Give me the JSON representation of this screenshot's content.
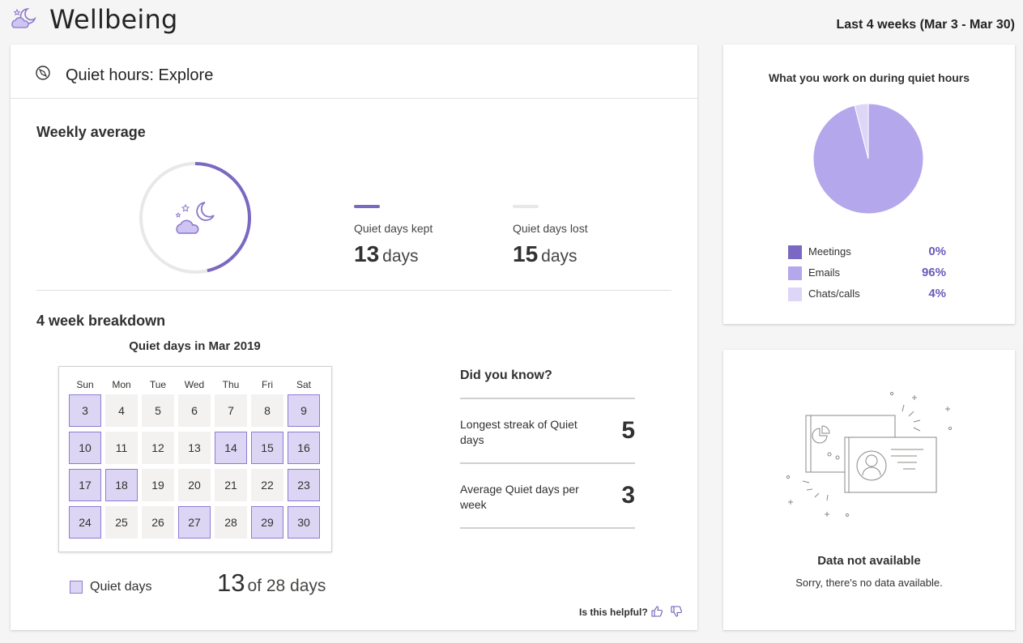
{
  "app": {
    "title": "Wellbeing",
    "date_range": "Last 4 weeks (Mar 3 - Mar 30)",
    "icon": "moon-cloud-icon"
  },
  "main": {
    "title": "Quiet hours: Explore",
    "title_icon": "compass-icon",
    "weekly_average": {
      "heading": "Weekly average",
      "kept_fraction": 0.464,
      "kept": {
        "label": "Quiet days kept",
        "value": "13",
        "unit": "days"
      },
      "lost": {
        "label": "Quiet days lost",
        "value": "15",
        "unit": "days"
      }
    },
    "breakdown": {
      "heading": "4 week breakdown",
      "calendar_title": "Quiet days in Mar 2019",
      "weekdays": [
        "Sun",
        "Mon",
        "Tue",
        "Wed",
        "Thu",
        "Fri",
        "Sat"
      ],
      "weeks": [
        [
          {
            "d": "3",
            "q": true
          },
          {
            "d": "4",
            "q": false
          },
          {
            "d": "5",
            "q": false
          },
          {
            "d": "6",
            "q": false
          },
          {
            "d": "7",
            "q": false
          },
          {
            "d": "8",
            "q": false
          },
          {
            "d": "9",
            "q": true
          }
        ],
        [
          {
            "d": "10",
            "q": true
          },
          {
            "d": "11",
            "q": false
          },
          {
            "d": "12",
            "q": false
          },
          {
            "d": "13",
            "q": false
          },
          {
            "d": "14",
            "q": true
          },
          {
            "d": "15",
            "q": true
          },
          {
            "d": "16",
            "q": true
          }
        ],
        [
          {
            "d": "17",
            "q": true
          },
          {
            "d": "18",
            "q": true
          },
          {
            "d": "19",
            "q": false
          },
          {
            "d": "20",
            "q": false
          },
          {
            "d": "21",
            "q": false
          },
          {
            "d": "22",
            "q": false
          },
          {
            "d": "23",
            "q": true
          }
        ],
        [
          {
            "d": "24",
            "q": true
          },
          {
            "d": "25",
            "q": false
          },
          {
            "d": "26",
            "q": false
          },
          {
            "d": "27",
            "q": true
          },
          {
            "d": "28",
            "q": false
          },
          {
            "d": "29",
            "q": true
          },
          {
            "d": "30",
            "q": true
          }
        ]
      ],
      "legend_label": "Quiet days",
      "summary_count": "13",
      "summary_rest": "of 28 days"
    },
    "did_you_know": {
      "heading": "Did you know?",
      "items": [
        {
          "label": "Longest streak of Quiet days",
          "value": "5"
        },
        {
          "label": "Average Quiet days per week",
          "value": "3"
        }
      ]
    },
    "feedback": {
      "label": "Is this helpful?",
      "up_icon": "thumbs-up-icon",
      "down_icon": "thumbs-down-icon"
    }
  },
  "pie": {
    "title": "What you work on during quiet hours",
    "items": [
      {
        "label": "Meetings",
        "pct": "0%",
        "value": 0,
        "color": "#7b68c2"
      },
      {
        "label": "Emails",
        "pct": "96%",
        "value": 96,
        "color": "#b5a7eb"
      },
      {
        "label": "Chats/calls",
        "pct": "4%",
        "value": 4,
        "color": "#ddd6f6"
      }
    ]
  },
  "empty": {
    "title": "Data not available",
    "text": "Sorry, there's no data available.",
    "illustration": "empty-data-illustration"
  },
  "colors": {
    "accent": "#7b68c2",
    "quiet_fill": "#dcd6f4",
    "ring_track": "#e8e8e8"
  }
}
